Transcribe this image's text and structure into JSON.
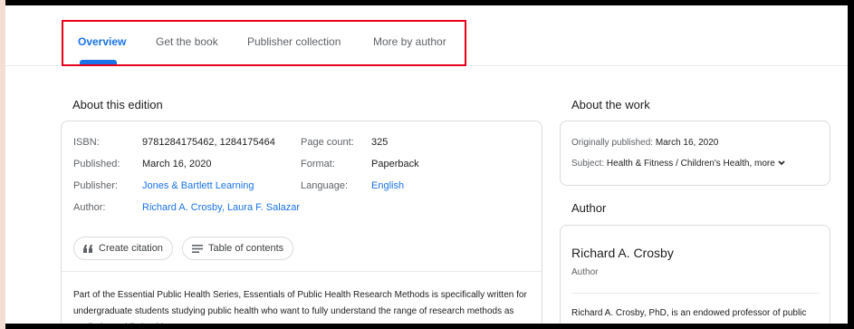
{
  "tabs": [
    {
      "label": "Overview",
      "active": true
    },
    {
      "label": "Get the book",
      "active": false
    },
    {
      "label": "Publisher collection",
      "active": false
    },
    {
      "label": "More by author",
      "active": false
    }
  ],
  "edition": {
    "title": "About this edition",
    "fields": {
      "isbn_label": "ISBN:",
      "isbn_value": "9781284175462, 1284175464",
      "published_label": "Published:",
      "published_value": "March 16, 2020",
      "publisher_label": "Publisher:",
      "publisher_value": "Jones & Bartlett Learning",
      "author_label": "Author:",
      "author_value": "Richard A. Crosby, Laura F. Salazar",
      "pagecount_label": "Page count:",
      "pagecount_value": "325",
      "format_label": "Format:",
      "format_value": "Paperback",
      "language_label": "Language:",
      "language_value": "English"
    },
    "buttons": {
      "citation": "Create citation",
      "toc": "Table of contents"
    },
    "description": "Part of the Essential Public Health Series, Essentials of Public Health Research Methods is specifically written for undergraduate students studying public health who want to fully understand the range of research methods as applied to public health."
  },
  "work": {
    "title": "About the work",
    "orig_label": "Originally published:",
    "orig_value": "March 16, 2020",
    "subject_label": "Subject:",
    "subject_value": "Health & Fitness / Children's Health,",
    "more_label": "more"
  },
  "author": {
    "title": "Author",
    "name": "Richard A. Crosby",
    "role": "Author",
    "bio": "Richard A. Crosby, PhD, is an endowed professor of public"
  },
  "colors": {
    "accent": "#1a73e8",
    "highlight": "#e8001c"
  }
}
